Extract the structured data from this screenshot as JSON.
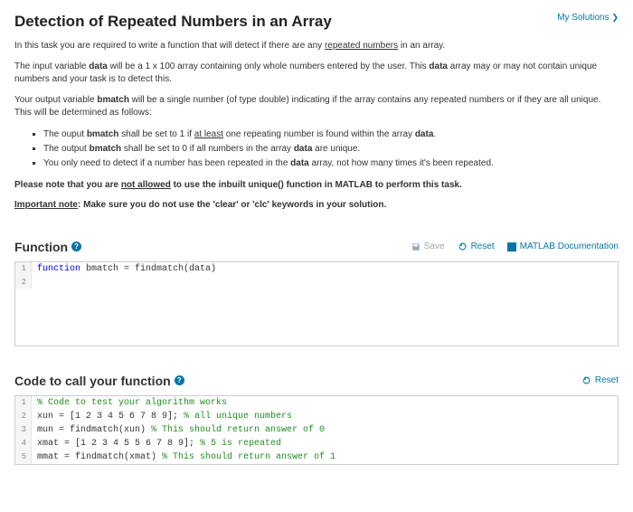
{
  "header": {
    "title": "Detection of Repeated Numbers in an Array",
    "my_solutions": "My Solutions"
  },
  "intro": {
    "p1a": "In this task you are required to write a function that will detect if there are any ",
    "p1u": "repeated numbers",
    "p1b": " in an array.",
    "p2a": "The input variable ",
    "p2b": "data",
    "p2c": " will be a 1 x 100 array containing only whole numbers entered by the user. This ",
    "p2d": "data",
    "p2e": " array may or may not contain unique numbers and your task is to detect this.",
    "p3a": "Your output variable ",
    "p3b": "bmatch",
    "p3c": " will be a single number (of type double) indicating if the array contains any repeated numbers or if they are all unique. This will be determined as follows:"
  },
  "bullets": {
    "b1a": "The ouput ",
    "b1b": "bmatch",
    "b1c": " shall be set to 1 if ",
    "b1d": "at least",
    "b1e": " one repeating number is found within the array ",
    "b1f": "data",
    "b1g": ".",
    "b2a": "The output ",
    "b2b": "bmatch",
    "b2c": " shall be set to 0 if all numbers in the array ",
    "b2d": "data",
    "b2e": " are unique.",
    "b3a": "You only need to detect if a number has been repeated in the ",
    "b3b": "data",
    "b3c": " array, not how many times it's been repeated."
  },
  "notes": {
    "n1a": "Please note that you are ",
    "n1b": "not allowed",
    "n1c": " to use the inbuilt unique() function in MATLAB to perform this task.",
    "n2a": "Important note",
    "n2b": ": Make sure you do not use the 'clear' or 'clc' keywords in your solution."
  },
  "function_section": {
    "title": "Function",
    "save": "Save",
    "reset": "Reset",
    "docs": "MATLAB Documentation",
    "line1_kw": "function",
    "line1_rest": " bmatch = findmatch(data)"
  },
  "call_section": {
    "title": "Code to call your function",
    "reset": "Reset",
    "l1": "% Code to test your algorithm works",
    "l2a": "xun = [1 2 3 4 5 6 7 8 9]; ",
    "l2b": "% all unique numbers",
    "l3a": "mun = findmatch(xun) ",
    "l3b": "% This should return answer of 0",
    "l4a": "xmat = [1 2 3 4 5 5 6 7 8 9]; ",
    "l4b": "% 5 is repeated",
    "l5a": "mmat = findmatch(xmat) ",
    "l5b": "% This should return answer of 1"
  },
  "gutter": {
    "1": "1",
    "2": "2",
    "3": "3",
    "4": "4",
    "5": "5"
  }
}
